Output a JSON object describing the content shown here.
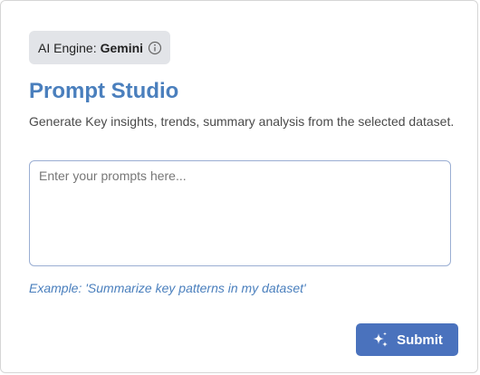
{
  "engine": {
    "label": "AI Engine:",
    "value": "Gemini",
    "info_icon": "info-icon"
  },
  "header": {
    "title": "Prompt Studio",
    "subtitle": "Generate Key insights, trends, summary analysis from the selected dataset."
  },
  "prompt": {
    "value": "",
    "placeholder": "Enter your prompts here..."
  },
  "example_text": "Example: 'Summarize key patterns in my dataset'",
  "submit": {
    "label": "Submit",
    "icon": "sparkle-icon"
  },
  "colors": {
    "accent": "#4a7fbd",
    "button": "#4a72bd",
    "badge_bg": "#e2e4e8"
  }
}
